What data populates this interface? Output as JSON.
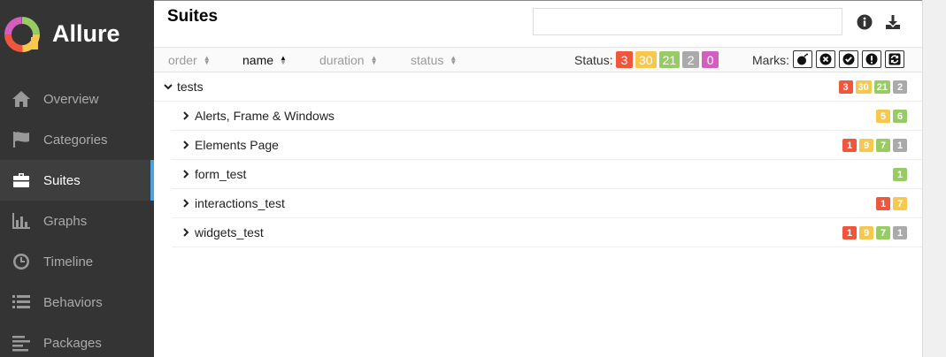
{
  "brand": {
    "name": "Allure"
  },
  "sidebar": {
    "items": [
      {
        "label": "Overview",
        "icon": "home-icon"
      },
      {
        "label": "Categories",
        "icon": "flag-icon"
      },
      {
        "label": "Suites",
        "icon": "briefcase-icon",
        "active": true
      },
      {
        "label": "Graphs",
        "icon": "bar-chart-icon"
      },
      {
        "label": "Timeline",
        "icon": "clock-icon"
      },
      {
        "label": "Behaviors",
        "icon": "list-icon"
      },
      {
        "label": "Packages",
        "icon": "align-left-icon"
      }
    ]
  },
  "main": {
    "title": "Suites",
    "search": {
      "value": "",
      "placeholder": ""
    },
    "sort": {
      "order": "order",
      "name": "name",
      "duration": "duration",
      "status": "status"
    },
    "status_label": "Status:",
    "status_counts": {
      "failed": "3",
      "broken": "30",
      "passed": "21",
      "skipped": "2",
      "unknown": "0"
    },
    "marks_label": "Marks:",
    "tree": {
      "root": {
        "label": "tests",
        "badges": [
          "3",
          "30",
          "21",
          "2"
        ]
      },
      "children": [
        {
          "label": "Alerts, Frame & Windows",
          "badges": {
            "broken": "5",
            "passed": "6"
          }
        },
        {
          "label": "Elements Page",
          "badges": {
            "failed": "1",
            "broken": "9",
            "passed": "7",
            "skipped": "1"
          }
        },
        {
          "label": "form_test",
          "badges": {
            "passed": "1"
          }
        },
        {
          "label": "interactions_test",
          "badges": {
            "failed": "1",
            "broken": "7"
          }
        },
        {
          "label": "widgets_test",
          "badges": {
            "failed": "1",
            "broken": "9",
            "passed": "7",
            "skipped": "1"
          }
        }
      ]
    }
  },
  "colors": {
    "failed": "#f0563c",
    "broken": "#f7c84d",
    "passed": "#97cc64",
    "skipped": "#aaaaaa",
    "unknown": "#d35ebe",
    "accent": "#4ca3dd",
    "sidebar": "#343434"
  }
}
